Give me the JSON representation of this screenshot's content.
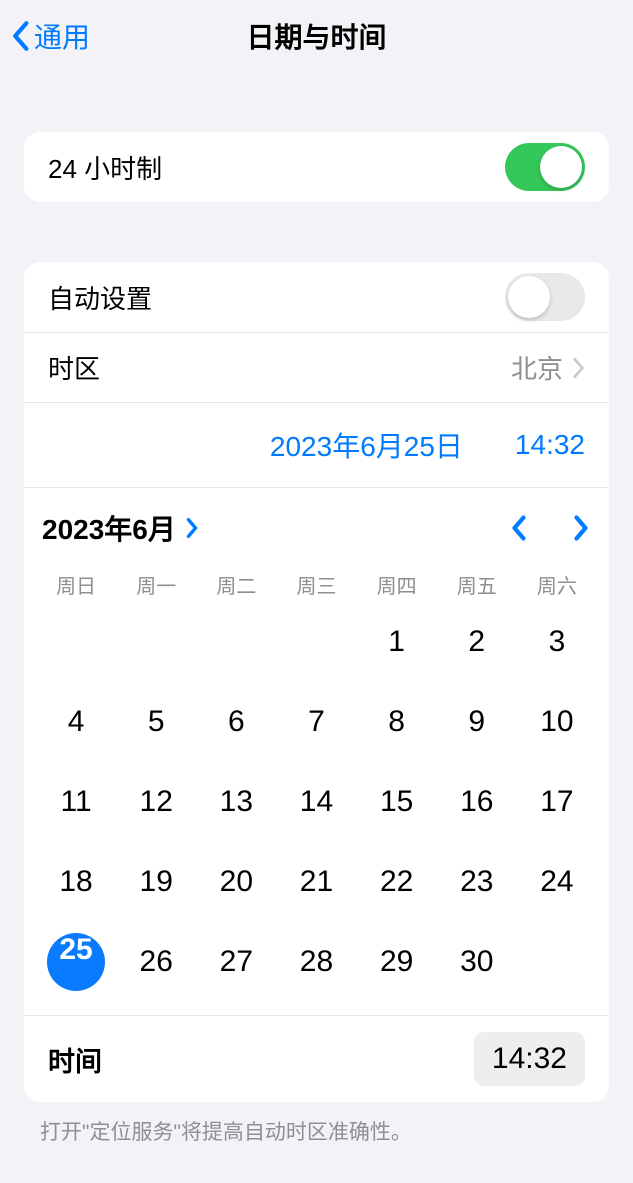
{
  "nav": {
    "back_label": "通用",
    "title": "日期与时间"
  },
  "group1": {
    "time_format_label": "24 小时制",
    "time_format_on": true
  },
  "group2": {
    "auto_set_label": "自动设置",
    "auto_set_on": false,
    "timezone_label": "时区",
    "timezone_value": "北京",
    "selected_date_display": "2023年6月25日",
    "selected_time_display": "14:32"
  },
  "calendar": {
    "month_label": "2023年6月",
    "weekdays": [
      "周日",
      "周一",
      "周二",
      "周三",
      "周四",
      "周五",
      "周六"
    ],
    "leading_blanks": 4,
    "days_in_month": 30,
    "selected_day": 25
  },
  "time_row": {
    "label": "时间",
    "value": "14:32"
  },
  "footer": {
    "note": "打开\"定位服务\"将提高自动时区准确性。"
  },
  "colors": {
    "accent": "#007aff",
    "switch_on": "#34c759"
  }
}
